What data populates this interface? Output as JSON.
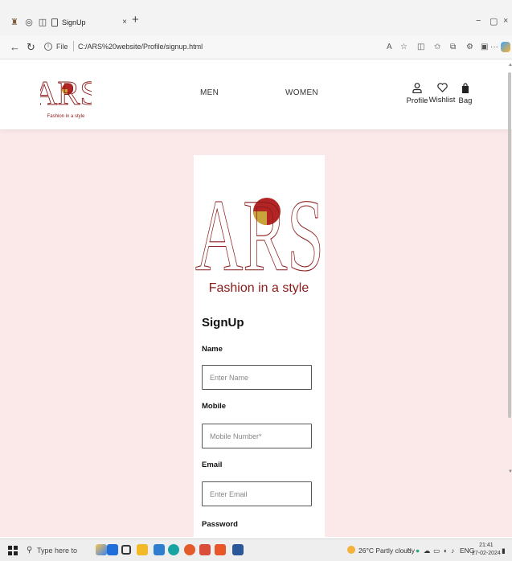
{
  "browser": {
    "tab_title": "SignUp",
    "tab_close": "×",
    "new_tab": "+",
    "file_label": "File",
    "url": "C:/ARS%20website/Profile/signup.html",
    "info_glyph": "i",
    "win_minimize": "−",
    "win_restore": "▢",
    "win_close": "×",
    "more_glyph": "···"
  },
  "site": {
    "logo_text": "ARS",
    "logo_tagline": "Fashion in a style",
    "nav": {
      "men": "MEN",
      "women": "WOMEN"
    },
    "actions": {
      "profile": "Profile",
      "wishlist": "Wishlist",
      "bag": "Bag"
    },
    "icons": {
      "profile": "person-icon",
      "wishlist": "heart-icon",
      "bag": "bag-icon"
    },
    "colors": {
      "page_bg": "#fbe9ea",
      "logo_outline": "#8b1a1a",
      "logo_red": "#b32424",
      "logo_gold": "#c9a43a"
    }
  },
  "form": {
    "title": "SignUp",
    "name_label": "Name",
    "name_placeholder": "Enter Name",
    "mobile_label": "Mobile",
    "mobile_placeholder": "Mobile Number*",
    "email_label": "Email",
    "email_placeholder": "Enter Email",
    "password_label": "Password"
  },
  "taskbar": {
    "search_placeholder": "Type here to search",
    "weather": "26°C Partly cloudy",
    "language": "ENG",
    "time": "21:41",
    "date": "27-02-2024"
  }
}
